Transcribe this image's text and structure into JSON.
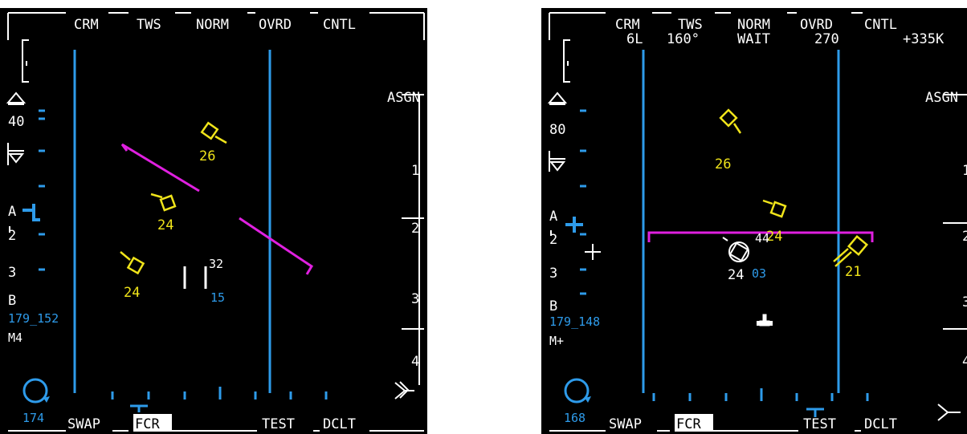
{
  "left_display": {
    "top_buttons": [
      "CRM",
      "TWS",
      "NORM",
      "OVRD",
      "CNTL"
    ],
    "top_sub": [
      "",
      "",
      "",
      "",
      ""
    ],
    "right_label": "ASGN",
    "right_numbers": [
      "1",
      "2",
      "3",
      "4"
    ],
    "altitude_scale": "40",
    "left_labels": [
      "A",
      "2",
      "3",
      "B"
    ],
    "cursor_readout": "179_152",
    "mode_label": "M4",
    "heading": "174",
    "bottom_buttons": [
      "SWAP",
      "FCR",
      "TEST",
      "DCLT"
    ],
    "tracks": [
      {
        "label": "26"
      },
      {
        "label": "24"
      },
      {
        "label": "24"
      }
    ],
    "cursor_top": "32",
    "cursor_bottom": "15"
  },
  "right_display": {
    "top_buttons": [
      "CRM",
      "TWS",
      "NORM",
      "OVRD",
      "CNTL"
    ],
    "top_sub": [
      "6L",
      "160°",
      "WAIT",
      "270",
      "+335K"
    ],
    "right_label": "ASGN",
    "right_numbers": [
      "1",
      "2",
      "3",
      "4"
    ],
    "altitude_scale": "80",
    "left_labels": [
      "A",
      "2",
      "3",
      "B"
    ],
    "cursor_readout": "179_148",
    "mode_label": "M+",
    "heading": "168",
    "bottom_buttons": [
      "SWAP",
      "FCR",
      "TEST",
      "DCLT"
    ],
    "tracks": [
      {
        "label": "26"
      },
      {
        "label": "24"
      },
      {
        "label": "21"
      }
    ],
    "bugged_track": {
      "altitude": "44",
      "label": "24",
      "aspect": "03"
    }
  },
  "colors": {
    "blue": "#2e9bea",
    "yellow": "#f0e41a",
    "magenta": "#e020e0",
    "white": "#ffffff",
    "background": "#000000"
  }
}
